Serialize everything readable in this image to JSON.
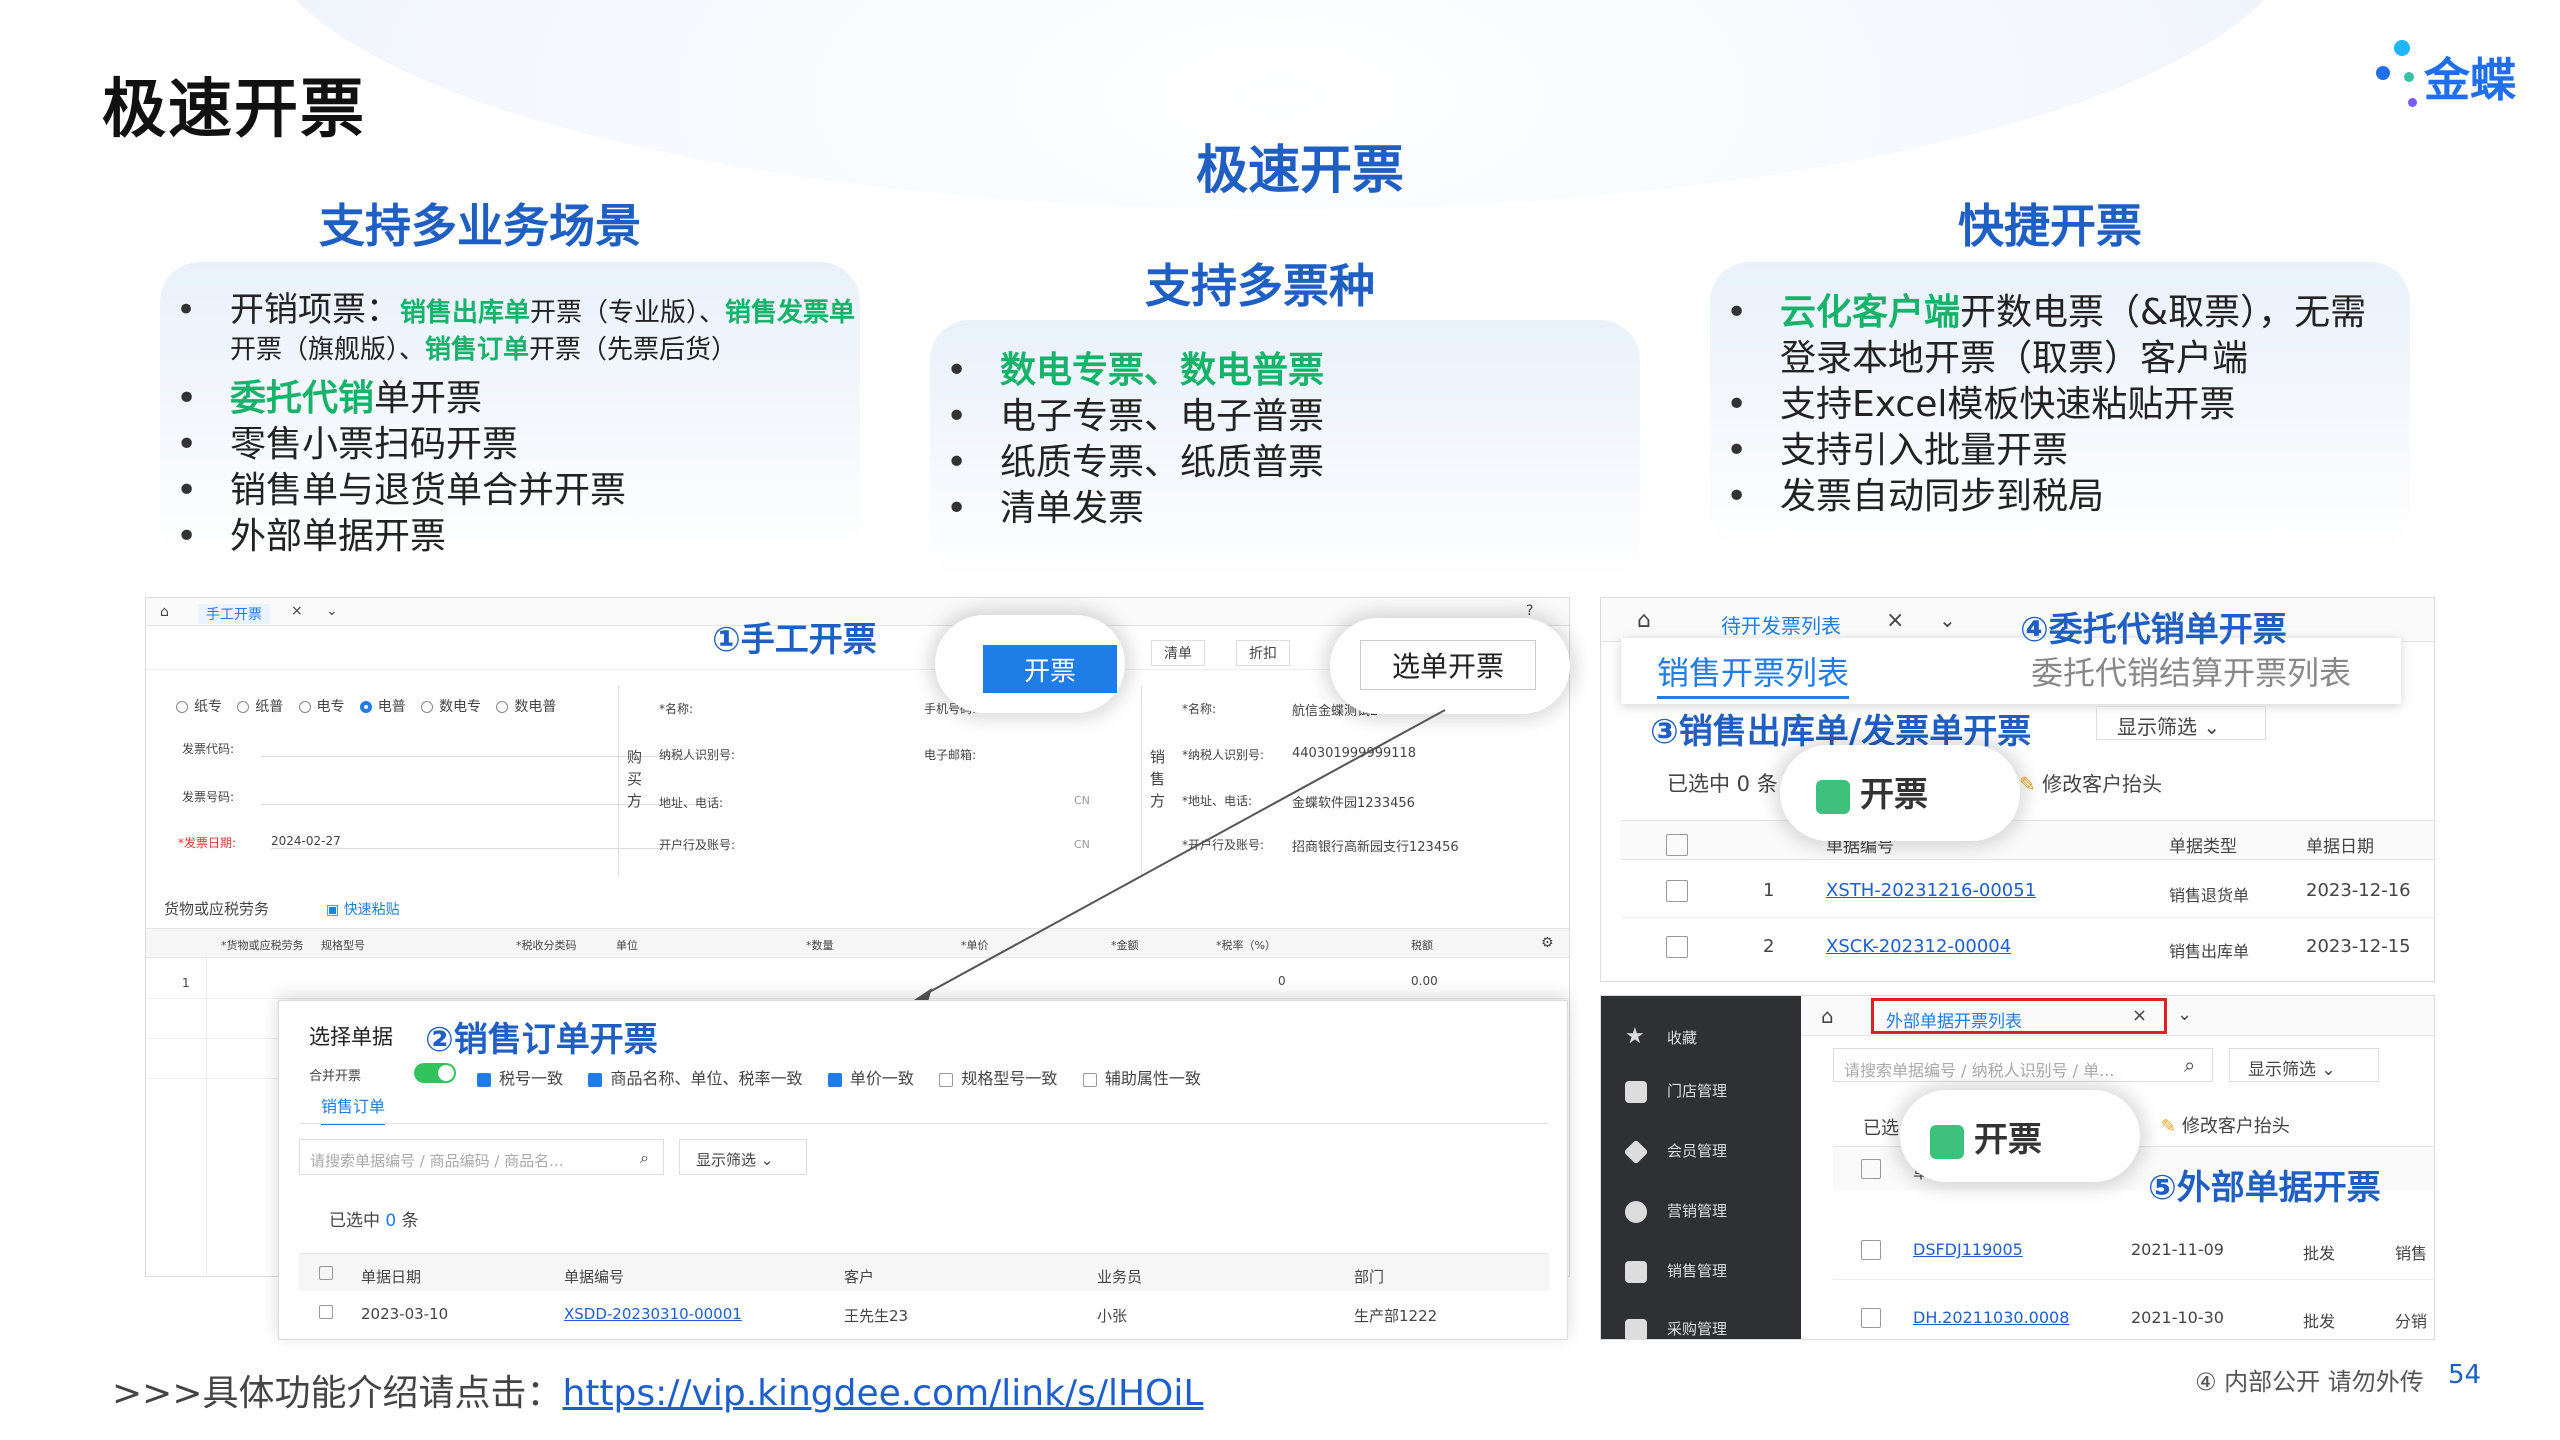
{
  "page_title": "极速开票",
  "logo": {
    "text": "金蝶",
    "dots": [
      "#1fb6ff",
      "#1f6feb",
      "#7b5cff",
      "#36c2a4"
    ]
  },
  "center": {
    "main_heading": "极速开票",
    "sub_heading": "支持多票种"
  },
  "left": {
    "heading": "支持多业务场景",
    "item1": {
      "prefix": "开销项票：",
      "a": "销售出库单",
      "b": "开票（专业版）、",
      "c": "销售发票单",
      "d": "开票（旗舰版）、",
      "e": "销售订单",
      "f": "开票（先票后货）"
    },
    "item2": {
      "hl": "委托代销",
      "rest": "单开票"
    },
    "item3": "零售小票扫码开票",
    "item4": "销售单与退货单合并开票",
    "item5": "外部单据开票"
  },
  "middle": {
    "items": [
      {
        "text": "数电专票、数电普票",
        "hl": true
      },
      {
        "text": "电子专票、电子普票"
      },
      {
        "text": "纸质专票、纸质普票"
      },
      {
        "text": "清单发票"
      }
    ]
  },
  "right": {
    "heading": "快捷开票",
    "item1": {
      "hl": "云化客户端",
      "rest": "开数电票（&取票），无需登录本地开票（取票）客户端"
    },
    "item2": "支持Excel模板快速粘贴开票",
    "item3": "支持引入批量开票",
    "item4": "发票自动同步到税局"
  },
  "annotations": {
    "a1": "①手工开票",
    "a2": "②销售订单开票",
    "a3": "③销售出库单/发票单开票",
    "a4": "④委托代销单开票",
    "a5": "⑤外部单据开票"
  },
  "shot1": {
    "tab": "手工开票",
    "btn_invoice": "开票",
    "btn_list": "清单",
    "btn_discount": "折扣",
    "btn_select": "选单开票",
    "radios": [
      "纸专",
      "纸普",
      "电专",
      "电普",
      "数电专",
      "数电普"
    ],
    "fields_left": [
      {
        "label": "发票代码:",
        "value": ""
      },
      {
        "label": "发票号码:",
        "value": ""
      },
      {
        "label": "*发票日期:",
        "value": "2024-02-27"
      }
    ],
    "buyer_label": "购买方",
    "buyer_fields": [
      "*名称:",
      "纳税人识别号:",
      "地址、电话:",
      "开户行及账号:"
    ],
    "buyer_fields2": [
      "手机号码:",
      "电子邮箱:"
    ],
    "seller_label": "销售方",
    "seller_fields": [
      {
        "label": "*名称:",
        "value": "航信金蝶测试2"
      },
      {
        "label": "*纳税人识别号:",
        "value": "440301999999118"
      },
      {
        "label": "*地址、电话:",
        "value": "金蝶软件园1233456"
      },
      {
        "label": "*开户行及账号:",
        "value": "招商银行高新园支行123456"
      }
    ],
    "goods_title": "货物或应税劳务",
    "quick_paste": "快速粘贴",
    "goods_cols": [
      "*货物或应税劳务",
      "规格型号",
      "*税收分类码",
      "单位",
      "*数量",
      "*单价",
      "*金额",
      "*税率（%）",
      "税额"
    ],
    "goods_row": {
      "idx": "1",
      "amount": "0",
      "tax": "0.00"
    },
    "cn": "CN"
  },
  "shot2": {
    "title": "选择单据",
    "merge": "合并开票",
    "checks": [
      {
        "label": "税号一致",
        "on": true
      },
      {
        "label": "商品名称、单位、税率一致",
        "on": true
      },
      {
        "label": "单价一致",
        "on": true
      },
      {
        "label": "规格型号一致",
        "on": false
      },
      {
        "label": "辅助属性一致",
        "on": false
      }
    ],
    "tab": "销售订单",
    "search_ph": "请搜索单据编号 / 商品编码 / 商品名...",
    "filter": "显示筛选",
    "selected_prefix": "已选中 ",
    "selected_count": "0",
    "selected_suffix": " 条",
    "cols": [
      "单据日期",
      "单据编号",
      "客户",
      "业务员",
      "部门"
    ],
    "row": [
      "2023-03-10",
      "XSDD-20230310-00001",
      "王先生23",
      "小张",
      "生产部1222"
    ]
  },
  "shot3": {
    "tab": "待开发票列表",
    "tab_a": "销售开票列表",
    "tab_b": "委托代销结算开票列表",
    "filter": "显示筛选",
    "selected": "已选中 0 条",
    "btn": "开票",
    "modify": "修改客户抬头",
    "cols": [
      "单据编号",
      "单据类型",
      "单据日期"
    ],
    "rows": [
      [
        "1",
        "XSTH-20231216-00051",
        "销售退货单",
        "2023-12-16"
      ],
      [
        "2",
        "XSCK-202312-00004",
        "销售出库单",
        "2023-12-15"
      ]
    ]
  },
  "shot4": {
    "tab": "外部单据开票列表",
    "search_ph": "请搜索单据编号 / 纳税人识别号 / 单...",
    "filter": "显示筛选",
    "selected": "已选",
    "btn": "开票",
    "modify": "修改客户抬头",
    "head": "单据",
    "side": [
      "收藏",
      "门店管理",
      "会员管理",
      "营销管理",
      "销售管理",
      "采购管理"
    ],
    "rows": [
      [
        "DSFDJ119005",
        "2021-11-09",
        "批发",
        "销售"
      ],
      [
        "DH.20211030.0008",
        "2021-10-30",
        "批发",
        "分销"
      ]
    ],
    "box_color": "#e02020"
  },
  "footer": {
    "prefix": ">>>具体功能介绍请点击：",
    "url": "https://vip.kingdee.com/link/s/lHOiL",
    "notice": "④ 内部公开 请勿外传",
    "page": "54"
  }
}
